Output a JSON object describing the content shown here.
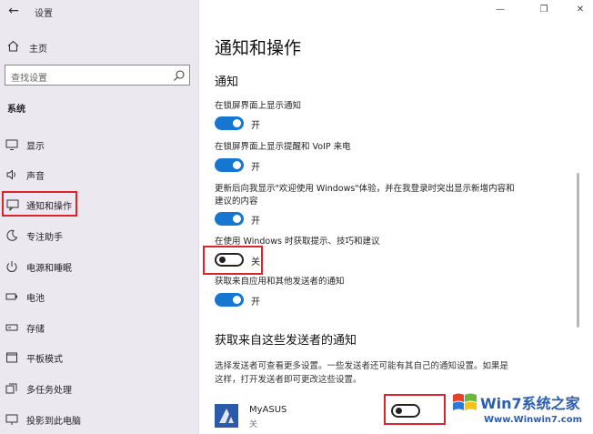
{
  "window": {
    "title": "设置"
  },
  "sidebar": {
    "home_label": "主页",
    "search_placeholder": "查找设置",
    "section_label": "系统",
    "items": [
      {
        "label": "显示",
        "icon": "monitor-icon"
      },
      {
        "label": "声音",
        "icon": "speaker-icon"
      },
      {
        "label": "通知和操作",
        "icon": "notification-icon",
        "selected": true
      },
      {
        "label": "专注助手",
        "icon": "moon-icon"
      },
      {
        "label": "电源和睡眠",
        "icon": "power-icon"
      },
      {
        "label": "电池",
        "icon": "battery-icon"
      },
      {
        "label": "存储",
        "icon": "storage-icon"
      },
      {
        "label": "平板模式",
        "icon": "tablet-icon"
      },
      {
        "label": "多任务处理",
        "icon": "multitask-icon"
      },
      {
        "label": "投影到此电脑",
        "icon": "project-icon"
      }
    ]
  },
  "main": {
    "title": "通知和操作",
    "notifications_heading": "通知",
    "settings": [
      {
        "label": "在锁屏界面上显示通知",
        "state": "开",
        "on": true
      },
      {
        "label": "在锁屏界面上显示提醒和 VoIP 来电",
        "state": "开",
        "on": true
      },
      {
        "label": "更新后向我显示\"欢迎使用 Windows\"体验，并在我登录时突出显示新增内容和建议的内容",
        "state": "开",
        "on": true
      },
      {
        "label": "在使用 Windows 时获取提示、技巧和建议",
        "state": "关",
        "on": false
      },
      {
        "label": "获取来自应用和其他发送者的通知",
        "state": "开",
        "on": true
      }
    ],
    "senders_heading": "获取来自这些发送者的通知",
    "senders_desc": "选择发送者可查看更多设置。一些发送者还可能有其自己的通知设置。如果是这样，打开发送者即可更改这些设置。",
    "app": {
      "name": "MyASUS",
      "state": "关",
      "on": false
    }
  },
  "watermark": {
    "brand": "Win7系统之家",
    "url": "Www.Winwin7.com"
  },
  "colors": {
    "accent": "#1677d2",
    "highlight": "#d9262e",
    "sidebar_bg": "#ece8f0"
  }
}
